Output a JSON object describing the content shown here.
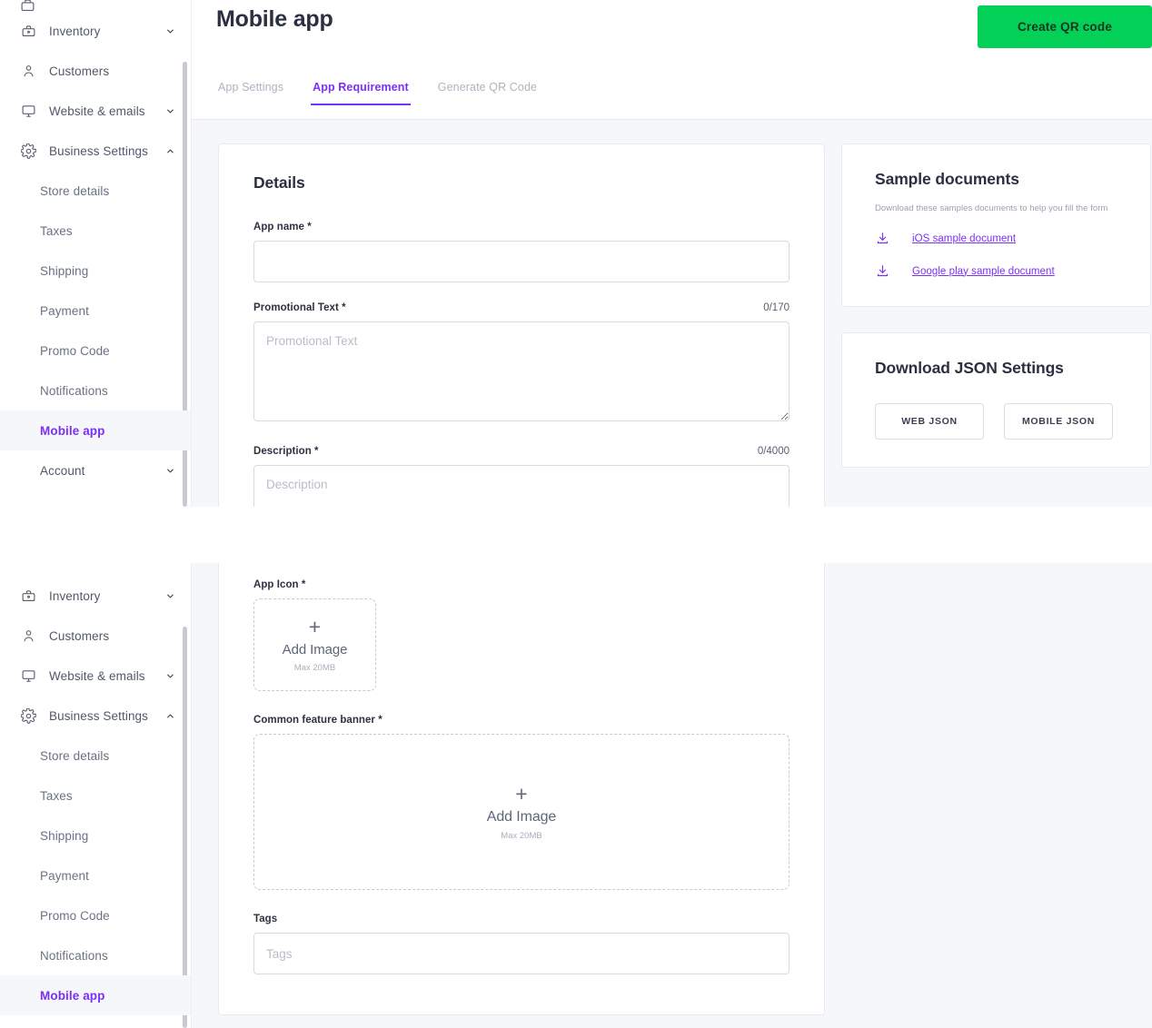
{
  "sidebar": {
    "items": [
      {
        "label": "Inventory",
        "icon": "inventory-icon",
        "expandable": true,
        "expanded": false
      },
      {
        "label": "Customers",
        "icon": "customers-icon",
        "expandable": false,
        "expanded": false
      },
      {
        "label": "Website & emails",
        "icon": "monitor-icon",
        "expandable": true,
        "expanded": false
      },
      {
        "label": "Business Settings",
        "icon": "gear-icon",
        "expandable": true,
        "expanded": true
      }
    ],
    "sub_items": [
      {
        "label": "Store details",
        "active": false
      },
      {
        "label": "Taxes",
        "active": false
      },
      {
        "label": "Shipping",
        "active": false
      },
      {
        "label": "Payment",
        "active": false
      },
      {
        "label": "Promo Code",
        "active": false
      },
      {
        "label": "Notifications",
        "active": false
      },
      {
        "label": "Mobile app",
        "active": true
      }
    ],
    "trailing": [
      {
        "label": "Account",
        "icon": null,
        "expandable": true,
        "expanded": false
      }
    ]
  },
  "header": {
    "title": "Mobile app",
    "primary_button": "Create QR code"
  },
  "tabs": [
    {
      "label": "App Settings",
      "active": false
    },
    {
      "label": "App Requirement",
      "active": true
    },
    {
      "label": "Generate QR Code",
      "active": false
    }
  ],
  "details_card": {
    "title": "Details",
    "fields": {
      "app_name": {
        "label": "App name *",
        "value": "",
        "placeholder": ""
      },
      "promotional_text": {
        "label": "Promotional Text *",
        "counter": "0/170",
        "value": "",
        "placeholder": "Promotional Text"
      },
      "description": {
        "label": "Description *",
        "counter": "0/4000",
        "value": "",
        "placeholder": "Description"
      },
      "app_icon": {
        "label": "App Icon *",
        "dropzone_label": "Add Image",
        "dropzone_sub": "Max 20MB",
        "plus": "+"
      },
      "common_feature_banner": {
        "label": "Common feature banner *",
        "dropzone_label": "Add Image",
        "dropzone_sub": "Max 20MB",
        "plus": "+"
      },
      "tags": {
        "label": "Tags",
        "value": "",
        "placeholder": "Tags"
      }
    }
  },
  "sample_documents_card": {
    "title": "Sample documents",
    "subtitle": "Download these samples documents to help you fill the form",
    "links": [
      {
        "label": "iOS sample document",
        "icon": "download-icon"
      },
      {
        "label": "Google play sample document",
        "icon": "download-icon"
      }
    ]
  },
  "json_card": {
    "title": "Download JSON Settings",
    "buttons": [
      {
        "label": "WEB JSON"
      },
      {
        "label": "MOBILE JSON"
      }
    ]
  },
  "colors": {
    "accent_purple": "#7b2ff7",
    "primary_green": "#03d157",
    "text_dark": "#2b2f42",
    "text_muted": "#6a7185",
    "bg_canvas": "#f6f7fa",
    "border": "#e9ebf0"
  }
}
